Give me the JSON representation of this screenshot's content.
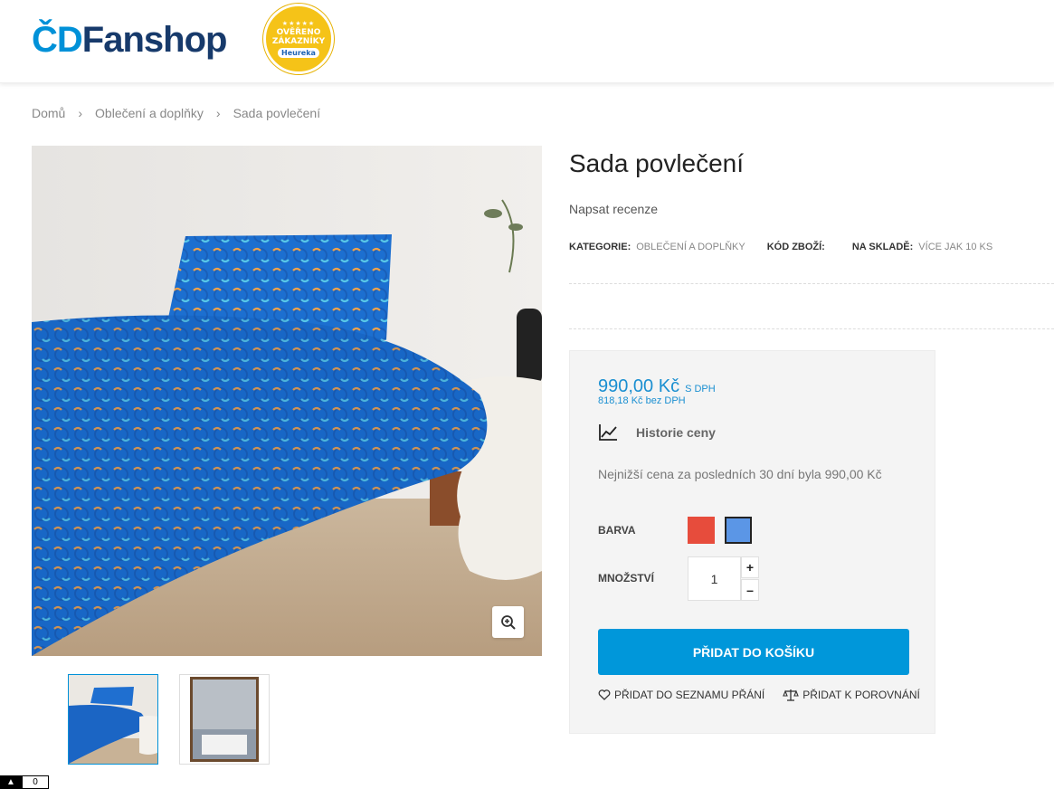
{
  "header": {
    "logo_prefix": "ČD",
    "logo_name": "Fanshop",
    "badge": {
      "stars": "★★★★★",
      "line1": "OVĚŘENO",
      "line2": "ZÁKAZNÍKY",
      "brand": "Heureka"
    }
  },
  "breadcrumb": {
    "items": [
      "Domů",
      "Oblečení a doplňky",
      "Sada povlečení"
    ],
    "separator": "›"
  },
  "product": {
    "title": "Sada povlečení",
    "review_link": "Napsat recenze",
    "meta": [
      {
        "label": "KATEGORIE:",
        "value": "OBLEČENÍ A DOPLŇKY"
      },
      {
        "label": "KÓD ZBOŽÍ:",
        "value": ""
      },
      {
        "label": "NA SKLADĚ:",
        "value": "VÍCE JAK 10 KS"
      }
    ]
  },
  "buybox": {
    "price": "990,00 Kč",
    "price_vat_note": "S DPH",
    "price_net": "818,18 Kč bez DPH",
    "history_label": "Historie ceny",
    "lowest_price_note": "Nejnižší cena za posledních 30 dní byla 990,00 Kč",
    "color_label": "BARVA",
    "colors": [
      {
        "name": "red",
        "hex": "#e74c3c",
        "selected": false
      },
      {
        "name": "blue",
        "hex": "#5b96e6",
        "selected": true
      }
    ],
    "quantity_label": "MNOŽSTVÍ",
    "quantity_value": "1",
    "plus": "+",
    "minus": "–",
    "add_to_cart": "PŘIDAT DO KOŠÍKU",
    "wishlist": "PŘIDAT DO SEZNAMU PŘÁNÍ",
    "compare": "PŘIDAT K POROVNÁNÍ"
  },
  "scroll": {
    "arrow": "▲",
    "count": "0"
  },
  "colors": {
    "accent": "#0097da",
    "brand_dark": "#173a6b",
    "badge": "#f5c318"
  }
}
